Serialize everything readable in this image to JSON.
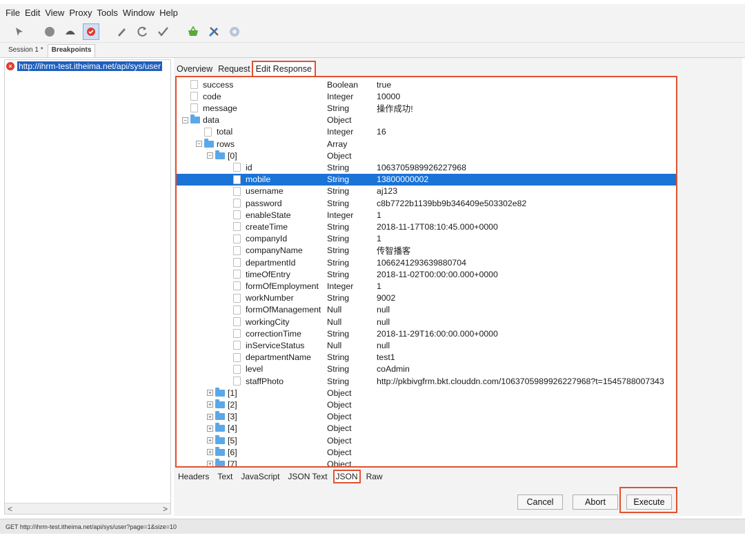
{
  "menu": [
    "File",
    "Edit",
    "View",
    "Proxy",
    "Tools",
    "Window",
    "Help"
  ],
  "toolbar_icons": [
    "pointer-icon",
    "record-icon",
    "throttle-icon",
    "breakpoint-icon",
    "pen-icon",
    "refresh-icon",
    "check-icon",
    "basket-icon",
    "tools-icon",
    "settings-icon"
  ],
  "session_tabs": [
    "Session 1 *",
    "Breakpoints"
  ],
  "left": {
    "url": "http://ihrm-test.itheima.net/api/sys/user"
  },
  "tabs": [
    "Overview",
    "Request",
    "Edit Response"
  ],
  "tree": [
    {
      "name": "success",
      "type": "Boolean",
      "value": "true",
      "depth": 0,
      "kind": "leaf"
    },
    {
      "name": "code",
      "type": "Integer",
      "value": "10000",
      "depth": 0,
      "kind": "leaf"
    },
    {
      "name": "message",
      "type": "String",
      "value": "操作成功!",
      "depth": 0,
      "kind": "leaf"
    },
    {
      "name": "data",
      "type": "Object",
      "value": "",
      "depth": 0,
      "kind": "folder"
    },
    {
      "name": "total",
      "type": "Integer",
      "value": "16",
      "depth": 1,
      "kind": "leaf"
    },
    {
      "name": "rows",
      "type": "Array",
      "value": "",
      "depth": 1,
      "kind": "folder"
    },
    {
      "name": "[0]",
      "type": "Object",
      "value": "",
      "depth": 2,
      "kind": "folder"
    },
    {
      "name": "id",
      "type": "String",
      "value": "1063705989926227968",
      "depth": 3,
      "kind": "leaf"
    },
    {
      "name": "mobile",
      "type": "String",
      "value": "13800000002",
      "depth": 3,
      "kind": "leaf",
      "selected": true
    },
    {
      "name": "username",
      "type": "String",
      "value": "aj123",
      "depth": 3,
      "kind": "leaf"
    },
    {
      "name": "password",
      "type": "String",
      "value": "c8b7722b1139bb9b346409e503302e82",
      "depth": 3,
      "kind": "leaf"
    },
    {
      "name": "enableState",
      "type": "Integer",
      "value": "1",
      "depth": 3,
      "kind": "leaf"
    },
    {
      "name": "createTime",
      "type": "String",
      "value": "2018-11-17T08:10:45.000+0000",
      "depth": 3,
      "kind": "leaf"
    },
    {
      "name": "companyId",
      "type": "String",
      "value": "1",
      "depth": 3,
      "kind": "leaf"
    },
    {
      "name": "companyName",
      "type": "String",
      "value": "传智播客",
      "depth": 3,
      "kind": "leaf"
    },
    {
      "name": "departmentId",
      "type": "String",
      "value": "1066241293639880704",
      "depth": 3,
      "kind": "leaf"
    },
    {
      "name": "timeOfEntry",
      "type": "String",
      "value": "2018-11-02T00:00:00.000+0000",
      "depth": 3,
      "kind": "leaf"
    },
    {
      "name": "formOfEmployment",
      "type": "Integer",
      "value": "1",
      "depth": 3,
      "kind": "leaf"
    },
    {
      "name": "workNumber",
      "type": "String",
      "value": "9002",
      "depth": 3,
      "kind": "leaf"
    },
    {
      "name": "formOfManagement",
      "type": "Null",
      "value": "null",
      "depth": 3,
      "kind": "leaf"
    },
    {
      "name": "workingCity",
      "type": "Null",
      "value": "null",
      "depth": 3,
      "kind": "leaf"
    },
    {
      "name": "correctionTime",
      "type": "String",
      "value": "2018-11-29T16:00:00.000+0000",
      "depth": 3,
      "kind": "leaf"
    },
    {
      "name": "inServiceStatus",
      "type": "Null",
      "value": "null",
      "depth": 3,
      "kind": "leaf"
    },
    {
      "name": "departmentName",
      "type": "String",
      "value": "test1",
      "depth": 3,
      "kind": "leaf"
    },
    {
      "name": "level",
      "type": "String",
      "value": "coAdmin",
      "depth": 3,
      "kind": "leaf"
    },
    {
      "name": "staffPhoto",
      "type": "String",
      "value": "http://pkbivgfrm.bkt.clouddn.com/1063705989926227968?t=1545788007343",
      "depth": 3,
      "kind": "leaf"
    },
    {
      "name": "[1]",
      "type": "Object",
      "value": "",
      "depth": 2,
      "kind": "collapsed"
    },
    {
      "name": "[2]",
      "type": "Object",
      "value": "",
      "depth": 2,
      "kind": "collapsed"
    },
    {
      "name": "[3]",
      "type": "Object",
      "value": "",
      "depth": 2,
      "kind": "collapsed"
    },
    {
      "name": "[4]",
      "type": "Object",
      "value": "",
      "depth": 2,
      "kind": "collapsed"
    },
    {
      "name": "[5]",
      "type": "Object",
      "value": "",
      "depth": 2,
      "kind": "collapsed"
    },
    {
      "name": "[6]",
      "type": "Object",
      "value": "",
      "depth": 2,
      "kind": "collapsed"
    },
    {
      "name": "[7]",
      "type": "Object",
      "value": "",
      "depth": 2,
      "kind": "collapsed"
    }
  ],
  "bottom_tabs": [
    "Headers",
    "Text",
    "JavaScript",
    "JSON Text",
    "JSON",
    "Raw"
  ],
  "buttons": {
    "cancel": "Cancel",
    "abort": "Abort",
    "execute": "Execute"
  },
  "status": "GET http://ihrm-test.itheima.net/api/sys/user?page=1&size=10",
  "colors": {
    "highlight": "#e2502f",
    "selection": "#1a73d6",
    "folder": "#5aa8e8"
  }
}
